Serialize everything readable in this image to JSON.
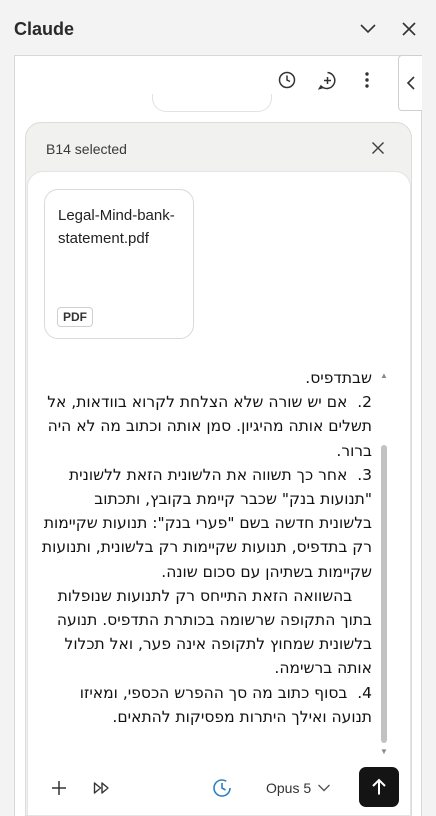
{
  "window": {
    "title": "Claude",
    "actions": [
      "chevron-down-icon",
      "close-icon"
    ]
  },
  "toolbar": {
    "icons": [
      "history-icon",
      "new-chat-icon",
      "more-vertical-icon"
    ]
  },
  "side_tab_icon": "chevron-left-icon",
  "selection": {
    "label": "B14 selected"
  },
  "attachment": {
    "file_name": "Legal-Mind-bank-statement.pdf",
    "badge": "PDF"
  },
  "message": {
    "text": "שבתדפיס.\n2.  אם יש שורה שלא הצלחת לקרוא בוודאות, אל תשלים אותה מהיגיון. סמן אותה וכתוב מה לא היה ברור.\n3.  אחר כך תשווה את הלשונית הזאת ללשונית \"תנועות בנק\" שכבר קיימת בקובץ, ותכתוב בלשונית חדשה בשם \"פערי בנק\": תנועות שקיימות רק בתדפיס, תנועות שקיימות רק בלשונית, ותנועות שקיימות בשתיהן עם סכום שונה.\n    בהשוואה הזאת התייחס רק לתנועות שנופלות בתוך התקופה שרשומה בכותרת התדפיס. תנועה בלשונית שמחוץ לתקופה אינה פער, ואל תכלול אותה ברשימה.\n4.  בסוף כתוב מה סך ההפרש הכספי, ומאיזו תנועה ואילך היתרות מפסיקות להתאים."
  },
  "composer": {
    "model": "Opus 5",
    "icons": [
      "plus-icon",
      "skip-forward-icon",
      "clock-icon",
      "send-arrow-icon"
    ]
  },
  "colors": {
    "clock_accent": "#2f7fc4",
    "send_bg": "#141414"
  }
}
